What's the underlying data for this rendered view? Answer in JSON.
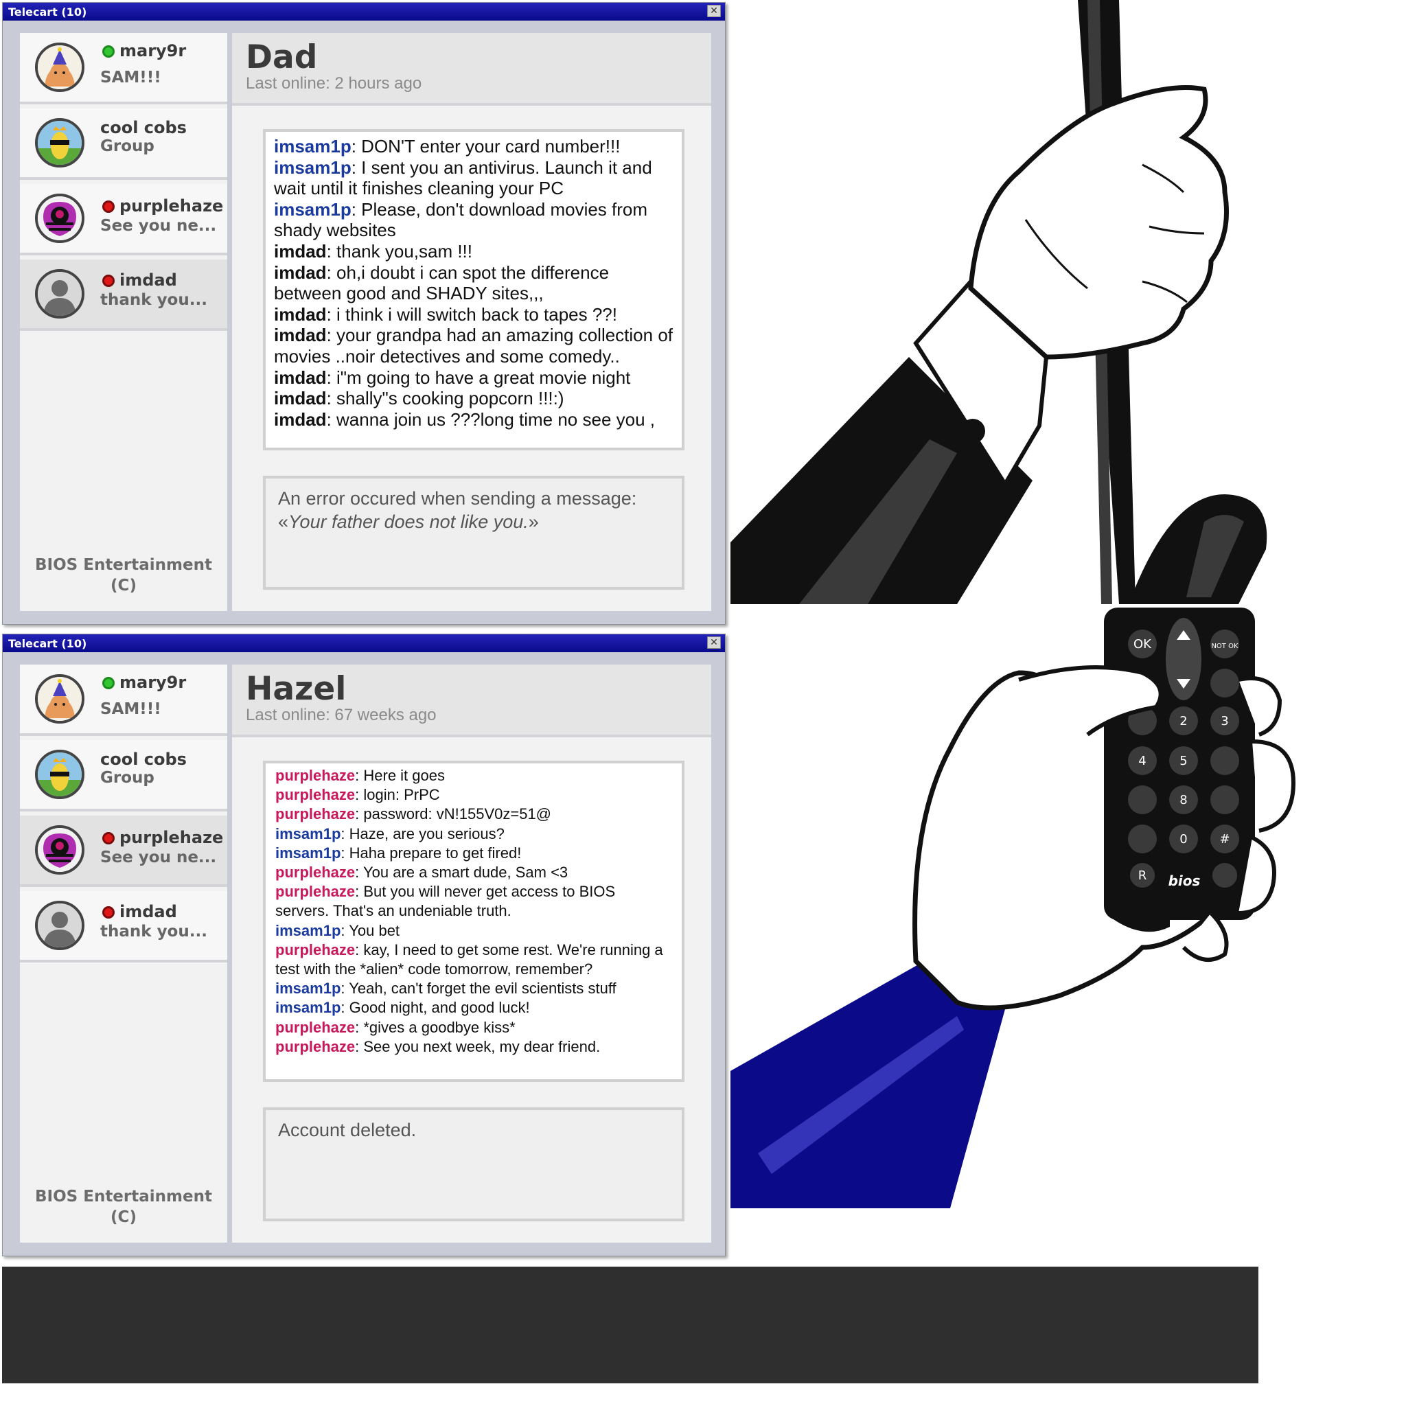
{
  "windows": [
    {
      "title": "Telecart (10)",
      "contacts": [
        {
          "name": "mary9r",
          "message": "SAM!!!",
          "status": "online",
          "avatar": "party-fox-avatar"
        },
        {
          "name": "cool cobs",
          "message": "Group",
          "status": "none",
          "avatar": "cool-corn-avatar"
        },
        {
          "name": "purplehaze",
          "message": "See you ne...",
          "status": "offline",
          "avatar": "purple-spider-avatar"
        },
        {
          "name": "imdad",
          "message": "thank you...",
          "status": "offline",
          "avatar": "gray-person-avatar"
        }
      ],
      "footer": {
        "line1": "BIOS Entertainment",
        "line2": "(C)"
      },
      "header": {
        "name": "Dad",
        "last_online": "Last online: 2 hours ago"
      },
      "messages": [
        {
          "user": "imsam1p",
          "text": ": DON'T enter your card number!!!"
        },
        {
          "user": "imsam1p",
          "text": ": I sent you an antivirus. Launch it and wait until it finishes cleaning your PC"
        },
        {
          "user": "imsam1p",
          "text": ": Please, don't download movies from shady websites"
        },
        {
          "user": "imdad",
          "text": ": thank you,sam !!!"
        },
        {
          "user": "imdad",
          "text": ": oh,i doubt i can spot the difference between good and SHADY sites,,,"
        },
        {
          "user": "imdad",
          "text": ": i think i will switch back to tapes ??!"
        },
        {
          "user": "imdad",
          "text": ": your grandpa had an amazing collection of movies ..noir detectives and some comedy.."
        },
        {
          "user": "imdad",
          "text": ": i\"m going to have a great movie night"
        },
        {
          "user": "imdad",
          "text": ": shally\"s cooking popcorn !!!:)"
        },
        {
          "user": "imdad",
          "text": ": wanna join us ???long time no see you ,"
        }
      ],
      "input_box": {
        "prefix": "An error occured when sending a message: «",
        "italic": "Your father does not like you.",
        "suffix": "»"
      }
    },
    {
      "title": "Telecart (10)",
      "contacts": [
        {
          "name": "mary9r",
          "message": "SAM!!!",
          "status": "online",
          "avatar": "party-fox-avatar"
        },
        {
          "name": "cool cobs",
          "message": "Group",
          "status": "none",
          "avatar": "cool-corn-avatar"
        },
        {
          "name": "purplehaze",
          "message": "See you ne...",
          "status": "offline",
          "avatar": "purple-spider-avatar"
        },
        {
          "name": "imdad",
          "message": "thank you...",
          "status": "offline",
          "avatar": "gray-person-avatar"
        }
      ],
      "footer": {
        "line1": "BIOS Entertainment",
        "line2": "(C)"
      },
      "header": {
        "name": "Hazel",
        "last_online": "Last online: 67 weeks ago"
      },
      "messages": [
        {
          "user": "purplehaze",
          "text": ": Here it goes"
        },
        {
          "user": "purplehaze",
          "text": ": login: PrPC"
        },
        {
          "user": "purplehaze",
          "text": ": password: vN!155V0z=51@"
        },
        {
          "user": "imsam1p",
          "text": ": Haze, are you serious?"
        },
        {
          "user": "imsam1p",
          "text": ": Haha prepare to get fired!"
        },
        {
          "user": "purplehaze",
          "text": ": You are a smart dude, Sam <3"
        },
        {
          "user": "purplehaze",
          "text": ": But you will never get access to BIOS servers. That's an undeniable truth."
        },
        {
          "user": "imsam1p",
          "text": ": You bet"
        },
        {
          "user": "purplehaze",
          "text": ": kay, I need to get some rest. We're running a test with the *alien* code tomorrow, remember?"
        },
        {
          "user": "imsam1p",
          "text": ": Yeah, can't forget the evil scientists stuff"
        },
        {
          "user": "imsam1p",
          "text": ": Good night, and good luck!"
        },
        {
          "user": "purplehaze",
          "text": ": *gives a goodbye kiss*"
        },
        {
          "user": "purplehaze",
          "text": ": See you next week, my dear friend."
        }
      ],
      "input_box": {
        "prefix": "Account deleted.",
        "italic": "",
        "suffix": ""
      }
    }
  ],
  "remote": {
    "brand": "bios",
    "keys": [
      "OK",
      "NOT OK",
      "2",
      "3",
      "4",
      "5",
      "8",
      "0",
      "#",
      "R"
    ]
  },
  "colors": {
    "title_bar": "#0a0a8c",
    "sam": "#1a3a9e",
    "purplehaze": "#c8195c",
    "online": "#33c633",
    "offline": "#e01818",
    "sleeve_blue": "#0b0b8a"
  }
}
